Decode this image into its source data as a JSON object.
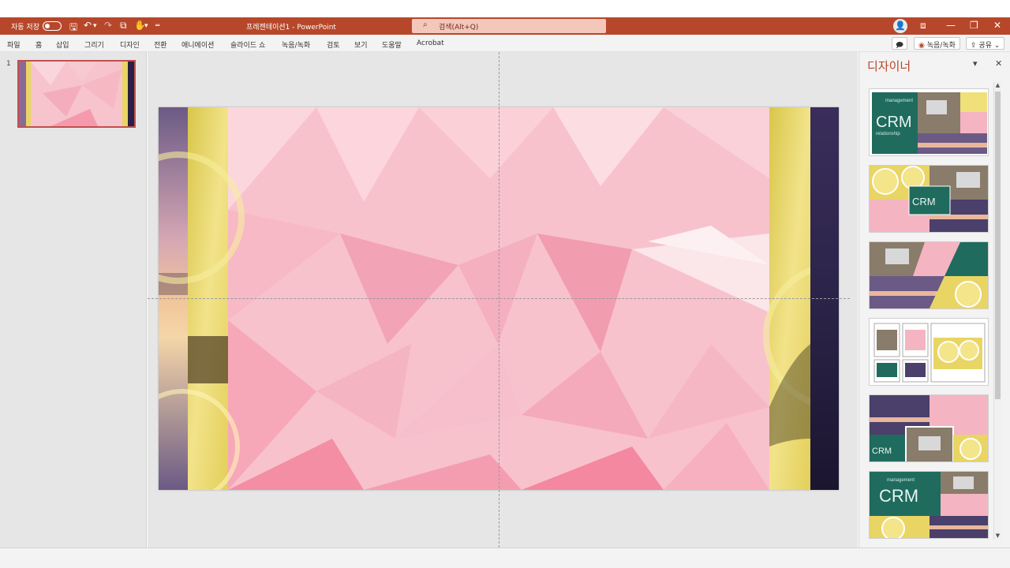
{
  "app": {
    "autosave_label": "자동 저장",
    "toggle_text": "끔",
    "doc_title": "프레젠테이션1 - PowerPoint",
    "search_placeholder": "검색(Alt+Q)"
  },
  "menu": {
    "tabs": [
      "파일",
      "홈",
      "삽입",
      "그리기",
      "디자인",
      "전환",
      "애니메이션",
      "슬라이드 쇼",
      "녹음/녹화",
      "검토",
      "보기",
      "도움말",
      "Acrobat"
    ],
    "record_label": "녹음/녹화",
    "share_label": "공유"
  },
  "slides_pane": {
    "number": "1"
  },
  "designer": {
    "title": "디자이너"
  },
  "icons": {
    "search": "search-icon",
    "save": "save-icon",
    "undo": "undo-icon",
    "redo": "redo-icon",
    "minimize": "minimize-icon",
    "restore": "restore-icon",
    "close": "close-icon",
    "comment": "comment-icon",
    "share": "share-icon",
    "record": "record-icon",
    "avatar": "avatar-icon"
  },
  "colors": {
    "accent": "#b7472a",
    "slide_pink": "#f7c0ca",
    "lemon": "#e8d564",
    "dusk": "#3a2d5c"
  },
  "design_ideas": {
    "crm_text": "CRM",
    "crm_sub": "relationship",
    "crm_top": "management"
  }
}
